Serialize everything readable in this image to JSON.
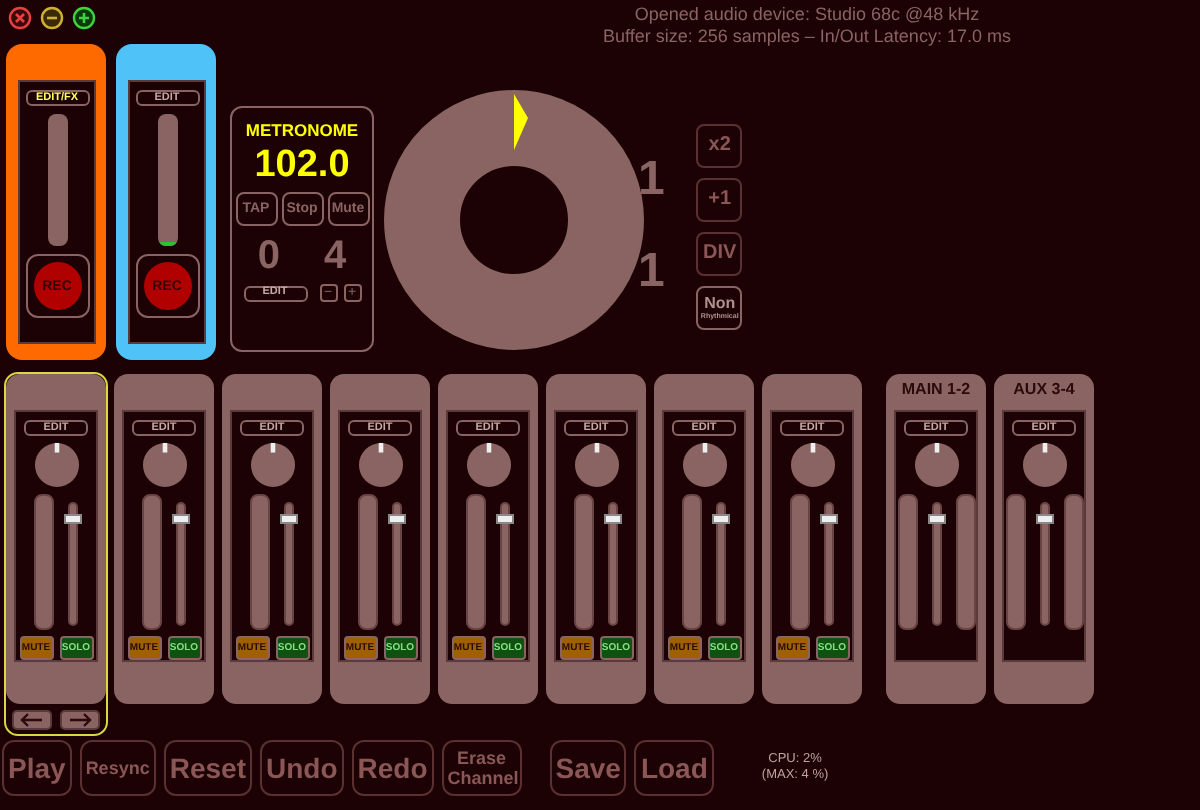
{
  "status": [
    "Opened audio device: Studio 68c @48 kHz",
    "Buffer size: 256 samples – In/Out Latency: 17.0 ms"
  ],
  "loops": [
    {
      "edit_label": "EDIT/FX",
      "rec_label": "REC",
      "color": "#ff6a00"
    },
    {
      "edit_label": "EDIT",
      "rec_label": "REC",
      "color": "#4fc3f7",
      "level": 0.03
    }
  ],
  "metronome": {
    "title": "METRONOME",
    "tempo": "102.0",
    "buttons": [
      "TAP",
      "Stop",
      "Mute"
    ],
    "beat": "0",
    "beats_per_bar": "4",
    "edit_label": "EDIT",
    "minus": "−",
    "plus": "+"
  },
  "counters": [
    "1",
    "1"
  ],
  "cycle_buttons": [
    {
      "label": "x2",
      "disabled": true
    },
    {
      "label": "+1",
      "disabled": true
    },
    {
      "label": "DIV",
      "disabled": true
    },
    {
      "label": "Non",
      "sublabel": "Rhythmical",
      "disabled": false
    }
  ],
  "channels": [
    {
      "kind": "loop",
      "edit_label": "EDIT",
      "mute_label": "MUTE",
      "solo_label": "SOLO",
      "level": 0.93,
      "selected": true
    },
    {
      "kind": "loop",
      "edit_label": "EDIT",
      "mute_label": "MUTE",
      "solo_label": "SOLO",
      "level": 0.93,
      "selected": false
    },
    {
      "kind": "loop",
      "edit_label": "EDIT",
      "mute_label": "MUTE",
      "solo_label": "SOLO",
      "level": 0.93,
      "selected": false
    },
    {
      "kind": "loop",
      "edit_label": "EDIT",
      "mute_label": "MUTE",
      "solo_label": "SOLO",
      "level": 0.93,
      "selected": false
    },
    {
      "kind": "loop",
      "edit_label": "EDIT",
      "mute_label": "MUTE",
      "solo_label": "SOLO",
      "level": 0.93,
      "selected": false
    },
    {
      "kind": "loop",
      "edit_label": "EDIT",
      "mute_label": "MUTE",
      "solo_label": "SOLO",
      "level": 0.93,
      "selected": false
    },
    {
      "kind": "loop",
      "edit_label": "EDIT",
      "mute_label": "MUTE",
      "solo_label": "SOLO",
      "level": 0.93,
      "selected": false
    },
    {
      "kind": "loop",
      "edit_label": "EDIT",
      "mute_label": "MUTE",
      "solo_label": "SOLO",
      "level": 0.93,
      "selected": false
    },
    {
      "kind": "output",
      "title": "MAIN 1-2",
      "edit_label": "EDIT",
      "level": 0.93
    },
    {
      "kind": "output",
      "title": "AUX 3-4",
      "edit_label": "EDIT",
      "level": 0.93
    }
  ],
  "transport": [
    {
      "label": "Play",
      "disabled": true
    },
    {
      "label": "Resync",
      "disabled": true
    },
    {
      "label": "Reset",
      "disabled": true
    },
    {
      "label": "Undo",
      "disabled": true
    },
    {
      "label": "Redo",
      "disabled": true
    },
    {
      "label": "Erase Channel",
      "disabled": true
    }
  ],
  "session": [
    {
      "label": "Save",
      "disabled": true
    },
    {
      "label": "Load",
      "disabled": true
    }
  ],
  "cpu": [
    "CPU: 2%",
    "(MAX: 4 %)"
  ]
}
